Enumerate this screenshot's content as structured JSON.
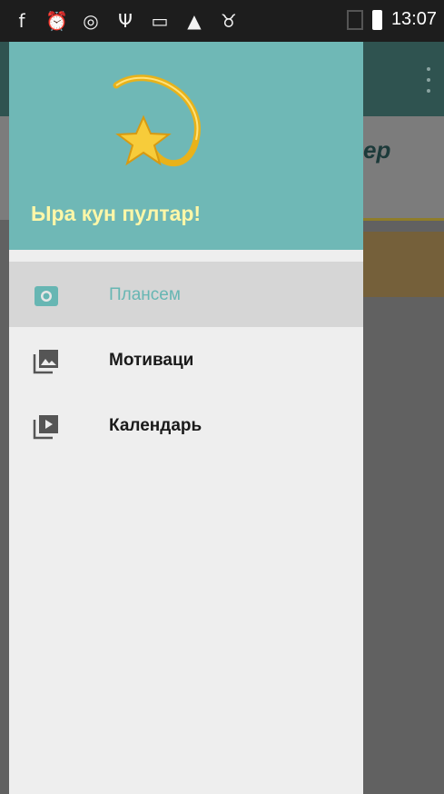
{
  "status_bar": {
    "time": "13:07",
    "icons": [
      "facebook-icon",
      "alarm-icon",
      "instagram-icon",
      "usb-icon",
      "image-icon",
      "warning-icon",
      "android-icon",
      "no-sim-icon",
      "battery-icon"
    ]
  },
  "app_behind": {
    "title_fragment": "ep"
  },
  "drawer": {
    "header_title": "Ыра кун пултар!",
    "items": [
      {
        "label": "Плансем",
        "icon": "camera-icon",
        "active": true
      },
      {
        "label": "Мотиваци",
        "icon": "photo-library-icon",
        "active": false
      },
      {
        "label": "Календарь",
        "icon": "video-library-icon",
        "active": false
      }
    ]
  },
  "colors": {
    "header_bg": "#6fb8b6",
    "header_title": "#fff7a8",
    "accent": "#67b6b3",
    "drawer_bg": "#eeeeee",
    "active_item_bg": "#d6d6d6"
  }
}
